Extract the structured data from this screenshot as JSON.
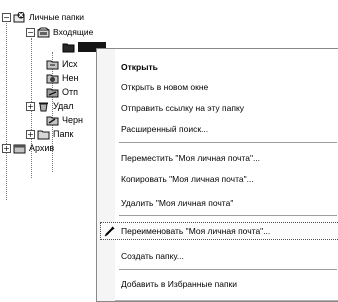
{
  "tree": {
    "root_label": "Личные папки",
    "inbox_label": "Входящие",
    "items": [
      {
        "label": "Исх"
      },
      {
        "label": "Нен"
      },
      {
        "label": "Отп"
      },
      {
        "label": "Удал"
      },
      {
        "label": "Черн"
      },
      {
        "label": "Папк"
      }
    ],
    "archive_label": "Архив"
  },
  "context_menu": {
    "items": [
      {
        "label": "Открыть",
        "u": "О"
      },
      {
        "label": "Открыть в новом окне",
        "u": ""
      },
      {
        "label": "Отправить ссылку на эту папку",
        "u": ""
      },
      {
        "label": "Расширенный поиск...",
        "u": ""
      },
      {
        "label": "Переместить \"Моя личная почта\"...",
        "u": "П"
      },
      {
        "label": "Копировать \"Моя личная почта\"...",
        "u": "К"
      },
      {
        "label": "Удалить \"Моя личная почта\"",
        "u": "У"
      },
      {
        "label": "Переименовать \"Моя личная почта\"...",
        "u": ""
      },
      {
        "label": "Создать папку...",
        "u": ""
      },
      {
        "label": "Добавить в Избранные папки",
        "u": ""
      }
    ]
  }
}
